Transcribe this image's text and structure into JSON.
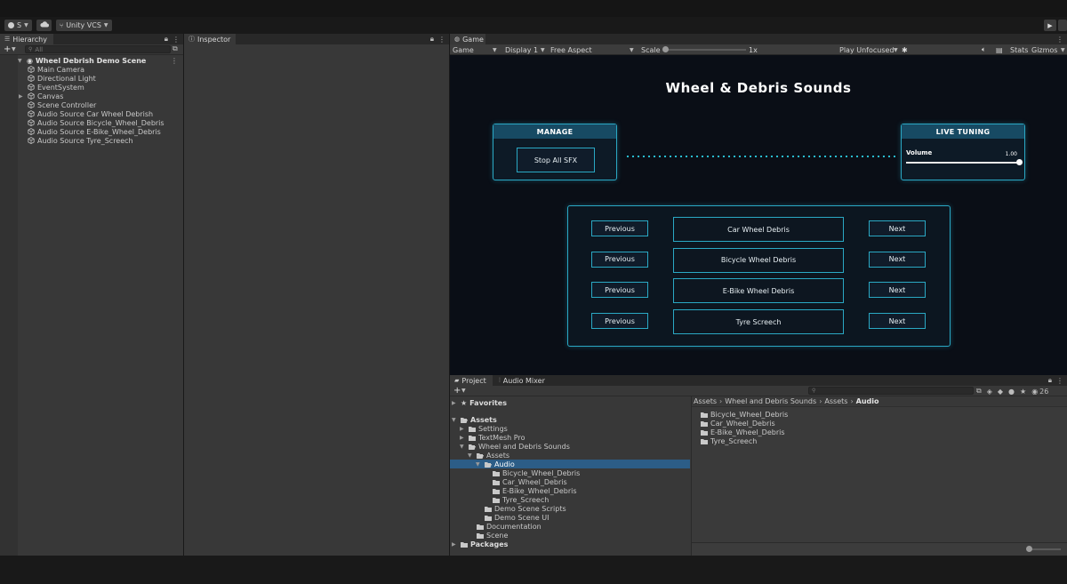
{
  "toolbar": {
    "account_label": "S",
    "vcs_label": "Unity VCS"
  },
  "hierarchy": {
    "tab_label": "Hierarchy",
    "search_placeholder": "All",
    "scene_name": "Wheel Debrish Demo Scene",
    "items": [
      {
        "label": "Main Camera",
        "expandable": false
      },
      {
        "label": "Directional Light",
        "expandable": false
      },
      {
        "label": "EventSystem",
        "expandable": false
      },
      {
        "label": "Canvas",
        "expandable": true
      },
      {
        "label": "Scene Controller",
        "expandable": false
      },
      {
        "label": "Audio Source Car Wheel Debrish",
        "expandable": false
      },
      {
        "label": "Audio Source Bicycle_Wheel_Debris",
        "expandable": false
      },
      {
        "label": "Audio Source E-Bike_Wheel_Debris",
        "expandable": false
      },
      {
        "label": "Audio Source Tyre_Screech",
        "expandable": false
      }
    ]
  },
  "inspector": {
    "tab_label": "Inspector"
  },
  "game": {
    "tab_label": "Game",
    "bar": {
      "view_mode": "Game",
      "display": "Display 1",
      "aspect": "Free Aspect",
      "scale_label": "Scale",
      "scale_value": "1x",
      "play_mode": "Play Unfocused",
      "stats": "Stats",
      "gizmos": "Gizmos"
    },
    "ui": {
      "title": "Wheel & Debris Sounds",
      "manage_header": "MANAGE",
      "stop_all_label": "Stop All SFX",
      "live_tuning_header": "LIVE TUNING",
      "volume_label": "Volume",
      "volume_value": "1.00",
      "volume_fraction": 1.0,
      "rows": [
        {
          "prev": "Previous",
          "name": "Car Wheel Debris",
          "next": "Next"
        },
        {
          "prev": "Previous",
          "name": "Bicycle Wheel Debris",
          "next": "Next"
        },
        {
          "prev": "Previous",
          "name": "E-Bike Wheel Debris",
          "next": "Next"
        },
        {
          "prev": "Previous",
          "name": "Tyre Screech",
          "next": "Next"
        }
      ]
    }
  },
  "project": {
    "tab_project": "Project",
    "tab_audio_mixer": "Audio Mixer",
    "hidden_count": "26",
    "tree": [
      {
        "label": "Favorites",
        "bold": true,
        "indent": 0,
        "arrow": "right",
        "icon": "star"
      },
      {
        "label": "Assets",
        "bold": true,
        "indent": 0,
        "arrow": "down",
        "icon": "folder-open"
      },
      {
        "label": "Settings",
        "bold": false,
        "indent": 1,
        "arrow": "right",
        "icon": "folder"
      },
      {
        "label": "TextMesh Pro",
        "bold": false,
        "indent": 1,
        "arrow": "right",
        "icon": "folder"
      },
      {
        "label": "Wheel and Debris Sounds",
        "bold": false,
        "indent": 1,
        "arrow": "down",
        "icon": "folder-open"
      },
      {
        "label": "Assets",
        "bold": false,
        "indent": 2,
        "arrow": "down",
        "icon": "folder-open"
      },
      {
        "label": "Audio",
        "bold": false,
        "indent": 3,
        "arrow": "down",
        "icon": "folder-open",
        "selected": true
      },
      {
        "label": "Bicycle_Wheel_Debris",
        "bold": false,
        "indent": 4,
        "arrow": "",
        "icon": "folder"
      },
      {
        "label": "Car_Wheel_Debris",
        "bold": false,
        "indent": 4,
        "arrow": "",
        "icon": "folder"
      },
      {
        "label": "E-Bike_Wheel_Debris",
        "bold": false,
        "indent": 4,
        "arrow": "",
        "icon": "folder"
      },
      {
        "label": "Tyre_Screech",
        "bold": false,
        "indent": 4,
        "arrow": "",
        "icon": "folder"
      },
      {
        "label": "Demo Scene Scripts",
        "bold": false,
        "indent": 3,
        "arrow": "",
        "icon": "folder"
      },
      {
        "label": "Demo Scene UI",
        "bold": false,
        "indent": 3,
        "arrow": "",
        "icon": "folder"
      },
      {
        "label": "Documentation",
        "bold": false,
        "indent": 2,
        "arrow": "",
        "icon": "folder"
      },
      {
        "label": "Scene",
        "bold": false,
        "indent": 2,
        "arrow": "",
        "icon": "folder"
      },
      {
        "label": "Packages",
        "bold": true,
        "indent": 0,
        "arrow": "right",
        "icon": "folder"
      }
    ],
    "breadcrumb": [
      "Assets",
      "Wheel and Debris Sounds",
      "Assets",
      "Audio"
    ],
    "files": [
      "Bicycle_Wheel_Debris",
      "Car_Wheel_Debris",
      "E-Bike_Wheel_Debris",
      "Tyre_Screech"
    ]
  },
  "colors": {
    "accent_cyan": "#2aa8c4",
    "selection_blue": "#2c5d87",
    "panel_bg": "#383838"
  }
}
